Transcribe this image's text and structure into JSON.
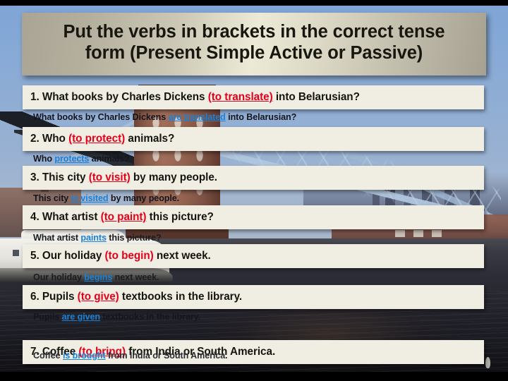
{
  "slide": {
    "title_line1": "Put the verbs in brackets in the correct tense",
    "title_line2": "form (Present Simple Active or Passive)",
    "background": "tower-bridge-london-photo",
    "colors": {
      "banner_light": "#ecead6",
      "banner_dark": "#a9a494",
      "bar_background": "#f0eee2",
      "prompt_verb_red": "#e4001b",
      "answer_blue": "#1b80d6",
      "text_black": "#15150f",
      "sky_blue": "#86a9d6",
      "water_dark": "#1e1e26"
    }
  },
  "items": [
    {
      "number": "1.",
      "question_before": "What books by Charles Dickens ",
      "question_verb": "(to translate)",
      "question_after": " into Belarusian?",
      "answer_before": "What books by Charles Dickens ",
      "answer_verb": "are translated",
      "answer_after": " into Belarusian?",
      "verb_underlined": true
    },
    {
      "number": "2.",
      "question_before": "Who ",
      "question_verb": "(to protect)",
      "question_after": " animals?",
      "answer_before": "Who ",
      "answer_verb": "protects",
      "answer_after": " animals?",
      "verb_underlined": true
    },
    {
      "number": "3.",
      "question_before": "This city ",
      "question_verb": "(to visit)",
      "question_after": " by many people.",
      "answer_before": "This city ",
      "answer_verb": "is visited",
      "answer_after": " by many people.",
      "verb_underlined": true
    },
    {
      "number": "4.",
      "question_before": "What artist ",
      "question_verb": "(to paint)",
      "question_after": " this picture?",
      "answer_before": "What artist ",
      "answer_verb": "paints",
      "answer_after": " this picture?",
      "verb_underlined": true
    },
    {
      "number": "5.",
      "question_before": "Our holiday ",
      "question_verb": "(to begin)",
      "question_after": " next week.",
      "answer_before": "Our holiday ",
      "answer_verb": "begins",
      "answer_after": " next week.",
      "verb_underlined": false
    },
    {
      "number": "6.",
      "question_before": "Pupils ",
      "question_verb": "(to give)",
      "question_after": " textbooks in the library.",
      "answer_before": "Pupils ",
      "answer_verb": "are given",
      "answer_after": " textbooks in the library.",
      "verb_underlined": true
    },
    {
      "number": "7.",
      "question_before": "Coffee ",
      "question_verb": "(to bring)",
      "question_after": " from India or South America.",
      "answer_before": "Coffee ",
      "answer_verb": "is brought",
      "answer_after": " from India or South America.",
      "verb_underlined": true
    }
  ]
}
